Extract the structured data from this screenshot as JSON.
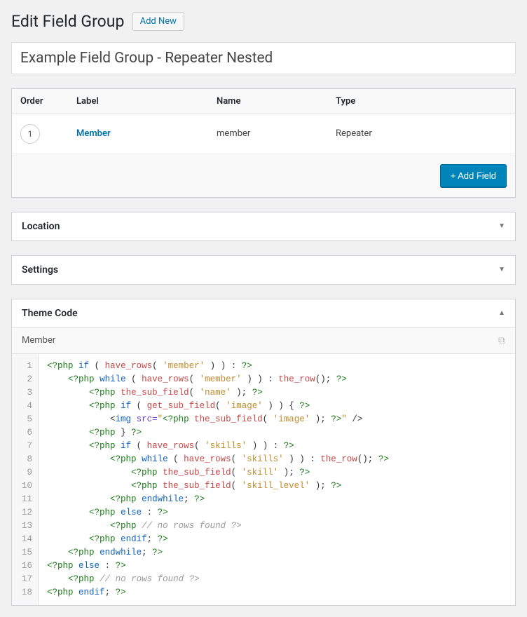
{
  "header": {
    "title": "Edit Field Group",
    "add_new": "Add New"
  },
  "group_title": "Example Field Group - Repeater Nested",
  "fields_table": {
    "headers": {
      "order": "Order",
      "label": "Label",
      "name": "Name",
      "type": "Type"
    },
    "rows": [
      {
        "order": "1",
        "label": "Member",
        "name": "member",
        "type": "Repeater"
      }
    ],
    "add_field": "+ Add Field"
  },
  "panels": {
    "location": "Location",
    "settings": "Settings",
    "theme_code": "Theme Code",
    "theme_code_field": "Member"
  },
  "code": {
    "lines": [
      "1",
      "2",
      "3",
      "4",
      "5",
      "6",
      "7",
      "8",
      "9",
      "10",
      "11",
      "12",
      "13",
      "14",
      "15",
      "16",
      "17",
      "18"
    ],
    "t": {
      "php_open": "<?php",
      "php_close": "?>",
      "if": "if",
      "while": "while",
      "else": "else",
      "endif": "endif",
      "endwhile": "endwhile",
      "have_rows": "have_rows",
      "the_row": "the_row",
      "the_sub_field": "the_sub_field",
      "get_sub_field": "get_sub_field",
      "s_member": "'member'",
      "s_name": "'name'",
      "s_image": "'image'",
      "s_skills": "'skills'",
      "s_skill": "'skill'",
      "s_skill_level": "'skill_level'",
      "lparen": "(",
      "rparen": ")",
      "space_r_space": " ) ",
      "colon": ":",
      "semi": ";",
      "lbrace": "{",
      "rbrace": "}",
      "lt": "<",
      "gt": ">",
      "slash_gt": "/>",
      "img": "img",
      "src_eq": "src=",
      "dq": "\"",
      "no_rows": "// no rows found ?>"
    }
  }
}
